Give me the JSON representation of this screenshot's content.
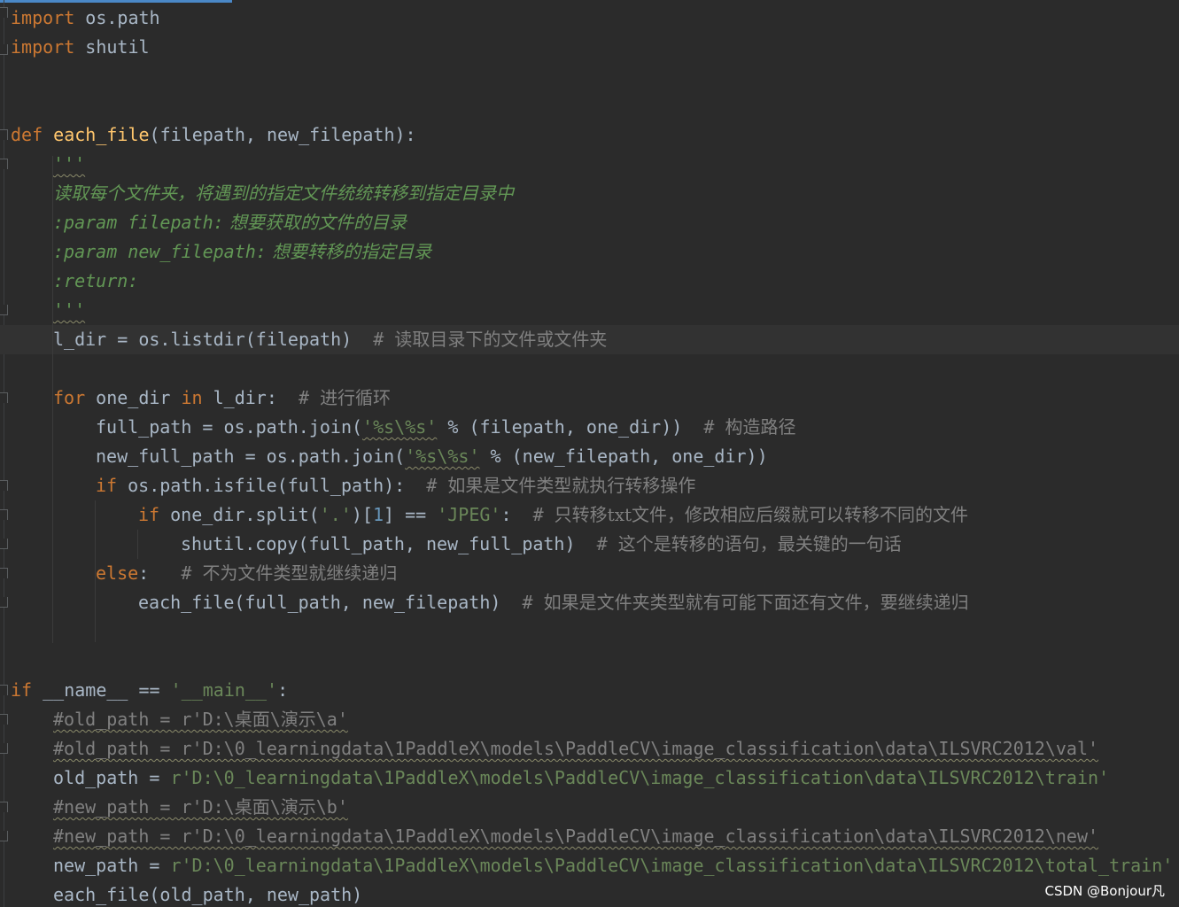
{
  "editor": {
    "language": "python",
    "lines": {
      "l1_kw": "import",
      "l1_rest": " os.path",
      "l2_kw": "import",
      "l2_rest": " shutil",
      "l5_kw": "def",
      "l5_fn": "each_file",
      "l5_rest": "(filepath, new_filepath):",
      "l6_doc": "'''",
      "l7_doc": "读取每个文件夹，将遇到的指定文件统统转移到指定目录中",
      "l8_p": ":param filepath:",
      "l8_doc": " 想要获取的文件的目录",
      "l9_p": ":param new_filepath:",
      "l9_doc": " 想要转移的指定目录",
      "l10_p": ":return:",
      "l11_doc": "'''",
      "l12_code": "l_dir = os.listdir(filepath)  ",
      "l12_hash": "# ",
      "l12_cmt": "读取目录下的文件或文件夹",
      "l14_kw1": "for",
      "l14_mid": " one_dir ",
      "l14_kw2": "in",
      "l14_rest": " l_dir:  ",
      "l14_hash": "# ",
      "l14_cmt": "进行循环",
      "l15_a": "full_path = os.path.join(",
      "l15_str": "'%s\\%s'",
      "l15_b": " % (filepath, one_dir))  ",
      "l15_hash": "# ",
      "l15_cmt": "构造路径",
      "l16_a": "new_full_path = os.path.join(",
      "l16_str": "'%s\\%s'",
      "l16_b": " % (new_filepath, one_dir))",
      "l17_kw": "if",
      "l17_rest": " os.path.isfile(full_path):  ",
      "l17_hash": "# ",
      "l17_cmt": "如果是文件类型就执行转移操作",
      "l18_kw": "if",
      "l18_a": " one_dir.split(",
      "l18_str1": "'.'",
      "l18_b": ")[",
      "l18_num": "1",
      "l18_c": "] == ",
      "l18_str2": "'JPEG'",
      "l18_d": ":  ",
      "l18_hash": "# ",
      "l18_cmt": "只转移txt文件，修改相应后缀就可以转移不同的文件",
      "l19_code": "shutil.copy(full_path, new_full_path)  ",
      "l19_hash": "# ",
      "l19_cmt": "这个是转移的语句，最关键的一句话",
      "l20_kw": "else",
      "l20_rest": ":   ",
      "l20_hash": "# ",
      "l20_cmt": "不为文件类型就继续递归",
      "l21_code": "each_file(full_path, new_filepath)  ",
      "l21_hash": "# ",
      "l21_cmt": "如果是文件夹类型就有可能下面还有文件，要继续递归",
      "l24_kw": "if",
      "l24_sp": " ",
      "l24_dunder": "__name__",
      "l24_eq": " == ",
      "l24_str": "'__main__'",
      "l24_colon": ":",
      "l25_cmt": "#old_path = r'D:\\桌面\\演示\\a'",
      "l26_cmt": "#old_path = r'D:\\0_learningdata\\1PaddleX\\models\\PaddleCV\\image_classification\\data\\ILSVRC2012\\val'",
      "l27_a": "old_path = ",
      "l27_str": "r'D:\\0_learningdata\\1PaddleX\\models\\PaddleCV\\image_classification\\data\\ILSVRC2012\\train'",
      "l28_cmt": "#new_path = r'D:\\桌面\\演示\\b'",
      "l29_cmt": "#new_path = r'D:\\0_learningdata\\1PaddleX\\models\\PaddleCV\\image_classification\\data\\ILSVRC2012\\new'",
      "l30_a": "new_path = ",
      "l30_str": "r'D:\\0_learningdata\\1PaddleX\\models\\PaddleCV\\image_classification\\data\\ILSVRC2012\\total_train'",
      "l31_code": "each_file(old_path, new_path)"
    }
  },
  "watermark": "CSDN @Bonjour凡",
  "colors": {
    "background": "#2b2b2b",
    "keyword": "#cc7832",
    "function": "#ffc66d",
    "string": "#6a8759",
    "docstring": "#629755",
    "comment": "#808080",
    "number": "#6897bb",
    "text": "#a9b7c6"
  }
}
